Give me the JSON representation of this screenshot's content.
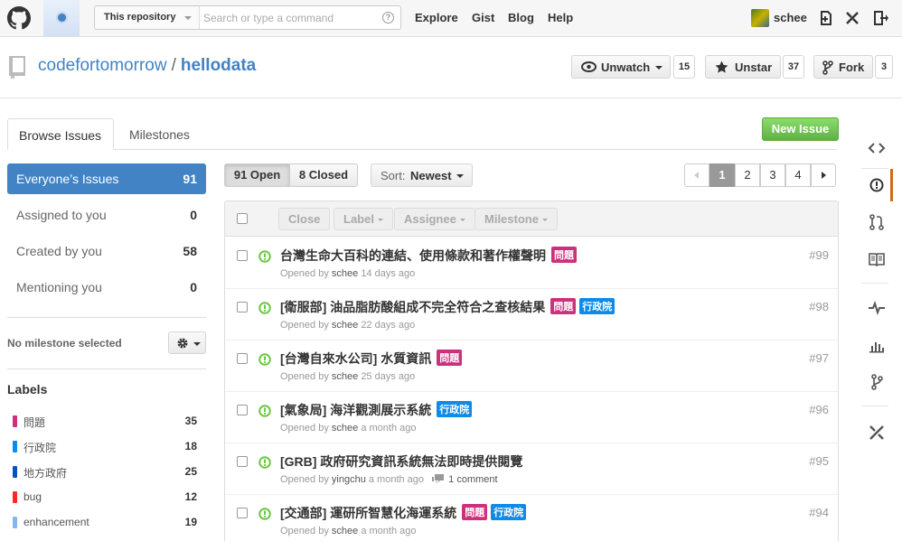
{
  "header": {
    "search_scope": "This repository",
    "search_placeholder": "Search or type a command",
    "nav": [
      "Explore",
      "Gist",
      "Blog",
      "Help"
    ],
    "username": "schee",
    "icons": [
      "octocat-logo-icon",
      "notification-dot-icon",
      "help-icon",
      "new-repo-icon",
      "settings-tools-icon",
      "sign-out-icon"
    ]
  },
  "repo": {
    "owner": "codefortomorrow",
    "separator": "/",
    "name": "hellodata",
    "watch_label": "Unwatch",
    "watch_count": "15",
    "star_label": "Unstar",
    "star_count": "37",
    "fork_label": "Fork",
    "fork_count": "3"
  },
  "tabs": [
    {
      "label": "Browse Issues",
      "active": true
    },
    {
      "label": "Milestones",
      "active": false
    }
  ],
  "new_issue_label": "New Issue",
  "filters": [
    {
      "label": "Everyone’s Issues",
      "count": "91",
      "selected": true
    },
    {
      "label": "Assigned to you",
      "count": "0",
      "selected": false
    },
    {
      "label": "Created by you",
      "count": "58",
      "selected": false
    },
    {
      "label": "Mentioning you",
      "count": "0",
      "selected": false
    }
  ],
  "milestone_label": "No milestone selected",
  "labels_title": "Labels",
  "labels": [
    {
      "name": "問題",
      "count": "35",
      "color": "#cc317c"
    },
    {
      "name": "行政院",
      "count": "18",
      "color": "#0e8ae8"
    },
    {
      "name": "地方政府",
      "count": "25",
      "color": "#0b4fc4"
    },
    {
      "name": "bug",
      "count": "12",
      "color": "#fc2929"
    },
    {
      "name": "enhancement",
      "count": "19",
      "color": "#84b6eb"
    }
  ],
  "state": {
    "open_label": "91 Open",
    "closed_label": "8 Closed"
  },
  "sort": {
    "prefix": "Sort:",
    "value": "Newest"
  },
  "pagination": {
    "pages": [
      "1",
      "2",
      "3",
      "4"
    ],
    "current": "1"
  },
  "actions": {
    "close": "Close",
    "label": "Label",
    "assignee": "Assignee",
    "milestone": "Milestone"
  },
  "issues": [
    {
      "title": "台灣生命大百科的連結、使用條款和著作權聲明",
      "tags": [
        {
          "text": "問題",
          "color": "#cc317c"
        }
      ],
      "opened": "Opened by",
      "author": "schee",
      "age": "14 days ago",
      "comments": "",
      "number": "#99"
    },
    {
      "title": "[衛服部] 油品脂肪酸組成不完全符合之查核結果",
      "tags": [
        {
          "text": "問題",
          "color": "#cc317c"
        },
        {
          "text": "行政院",
          "color": "#0e8ae8"
        }
      ],
      "opened": "Opened by",
      "author": "schee",
      "age": "22 days ago",
      "comments": "",
      "number": "#98"
    },
    {
      "title": "[台灣自來水公司] 水質資訊",
      "tags": [
        {
          "text": "問題",
          "color": "#cc317c"
        }
      ],
      "opened": "Opened by",
      "author": "schee",
      "age": "25 days ago",
      "comments": "",
      "number": "#97"
    },
    {
      "title": "[氣象局] 海洋觀測展示系統",
      "tags": [
        {
          "text": "行政院",
          "color": "#0e8ae8"
        }
      ],
      "opened": "Opened by",
      "author": "schee",
      "age": "a month ago",
      "comments": "",
      "number": "#96"
    },
    {
      "title": "[GRB] 政府研究資訊系統無法即時提供閱覽",
      "tags": [],
      "opened": "Opened by",
      "author": "yingchu",
      "age": "a month ago",
      "comments": "1 comment",
      "number": "#95"
    },
    {
      "title": "[交通部] 運研所智慧化海運系統",
      "tags": [
        {
          "text": "問題",
          "color": "#cc317c"
        },
        {
          "text": "行政院",
          "color": "#0e8ae8"
        }
      ],
      "opened": "Opened by",
      "author": "schee",
      "age": "a month ago",
      "comments": "",
      "number": "#94"
    }
  ],
  "sidebar_icons": [
    "code-icon",
    "issues-icon",
    "pull-requests-icon",
    "wiki-icon",
    "pulse-icon",
    "graphs-icon",
    "network-icon",
    "settings-icon"
  ],
  "colors": {
    "link": "#4183c4",
    "new_issue_green": "#60b044",
    "open_icon": "#6cc644",
    "active_nav": "#d26911"
  }
}
